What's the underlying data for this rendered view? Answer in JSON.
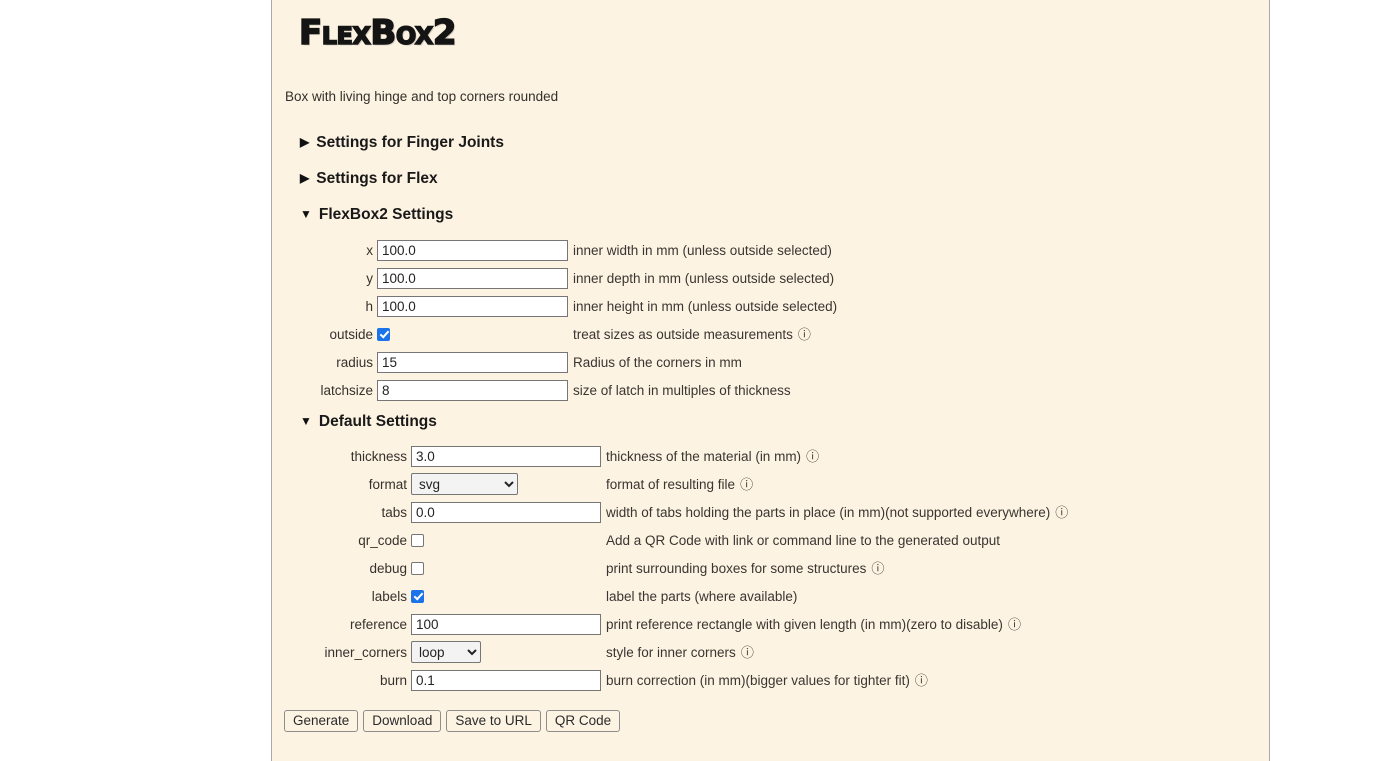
{
  "app": {
    "logo_text": "FlexBox2",
    "subtitle": "Box with living hinge and top corners rounded"
  },
  "sections": [
    {
      "title": "Settings for Finger Joints",
      "expanded": false,
      "marker": "closed-triangle-icon"
    },
    {
      "title": "Settings for Flex",
      "expanded": false,
      "marker": "closed-triangle-icon"
    },
    {
      "title": "FlexBox2 Settings",
      "expanded": true,
      "marker": "open-triangle-icon"
    },
    {
      "title": "Default Settings",
      "expanded": true,
      "marker": "open-triangle-icon"
    }
  ],
  "flexbox2_settings": {
    "fields": [
      {
        "label": "x",
        "type": "text",
        "value": "100.0",
        "description": "inner width in mm (unless outside selected)",
        "info": false
      },
      {
        "label": "y",
        "type": "text",
        "value": "100.0",
        "description": "inner depth in mm (unless outside selected)",
        "info": false
      },
      {
        "label": "h",
        "type": "text",
        "value": "100.0",
        "description": "inner height in mm (unless outside selected)",
        "info": false
      },
      {
        "label": "outside",
        "type": "checkbox",
        "checked": true,
        "description": "treat sizes as outside measurements",
        "info": true
      },
      {
        "label": "radius",
        "type": "text",
        "value": "15",
        "description": "Radius of the corners in mm",
        "info": false
      },
      {
        "label": "latchsize",
        "type": "text",
        "value": "8",
        "description": "size of latch in multiples of thickness",
        "info": false
      }
    ]
  },
  "default_settings": {
    "fields": [
      {
        "label": "thickness",
        "type": "text",
        "value": "3.0",
        "description": "thickness of the material (in mm)",
        "info": true
      },
      {
        "label": "format",
        "type": "select",
        "value": "svg",
        "options": [
          "svg"
        ],
        "description": "format of resulting file",
        "info": true
      },
      {
        "label": "tabs",
        "type": "text",
        "value": "0.0",
        "description": "width of tabs holding the parts in place (in mm)(not supported everywhere)",
        "info": true
      },
      {
        "label": "qr_code",
        "type": "checkbox",
        "checked": false,
        "description": "Add a QR Code with link or command line to the generated output",
        "info": false
      },
      {
        "label": "debug",
        "type": "checkbox",
        "checked": false,
        "description": "print surrounding boxes for some structures",
        "info": true
      },
      {
        "label": "labels",
        "type": "checkbox",
        "checked": true,
        "description": "label the parts (where available)",
        "info": false
      },
      {
        "label": "reference",
        "type": "text",
        "value": "100",
        "description": "print reference rectangle with given length (in mm)(zero to disable)",
        "info": true
      },
      {
        "label": "inner_corners",
        "type": "select",
        "value": "loop",
        "options": [
          "loop"
        ],
        "description": "style for inner corners",
        "info": true
      },
      {
        "label": "burn",
        "type": "text",
        "value": "0.1",
        "description": "burn correction (in mm)(bigger values for tighter fit)",
        "info": true
      }
    ]
  },
  "buttons": [
    {
      "label": "Generate",
      "name": "generate-button"
    },
    {
      "label": "Download",
      "name": "download-button"
    },
    {
      "label": "Save to URL",
      "name": "save-to-url-button"
    },
    {
      "label": "QR Code",
      "name": "qr-code-button"
    }
  ],
  "icons": {
    "info": "ⓘ",
    "closed_triangle": "▶",
    "open_triangle": "▼"
  },
  "colors": {
    "page_background": "#fdf3e3",
    "outer_background": "#ffffff",
    "border": "#a9a9a9",
    "text": "#3a3530",
    "heading": "#191919",
    "checkbox_checked": "#1a73e8"
  }
}
